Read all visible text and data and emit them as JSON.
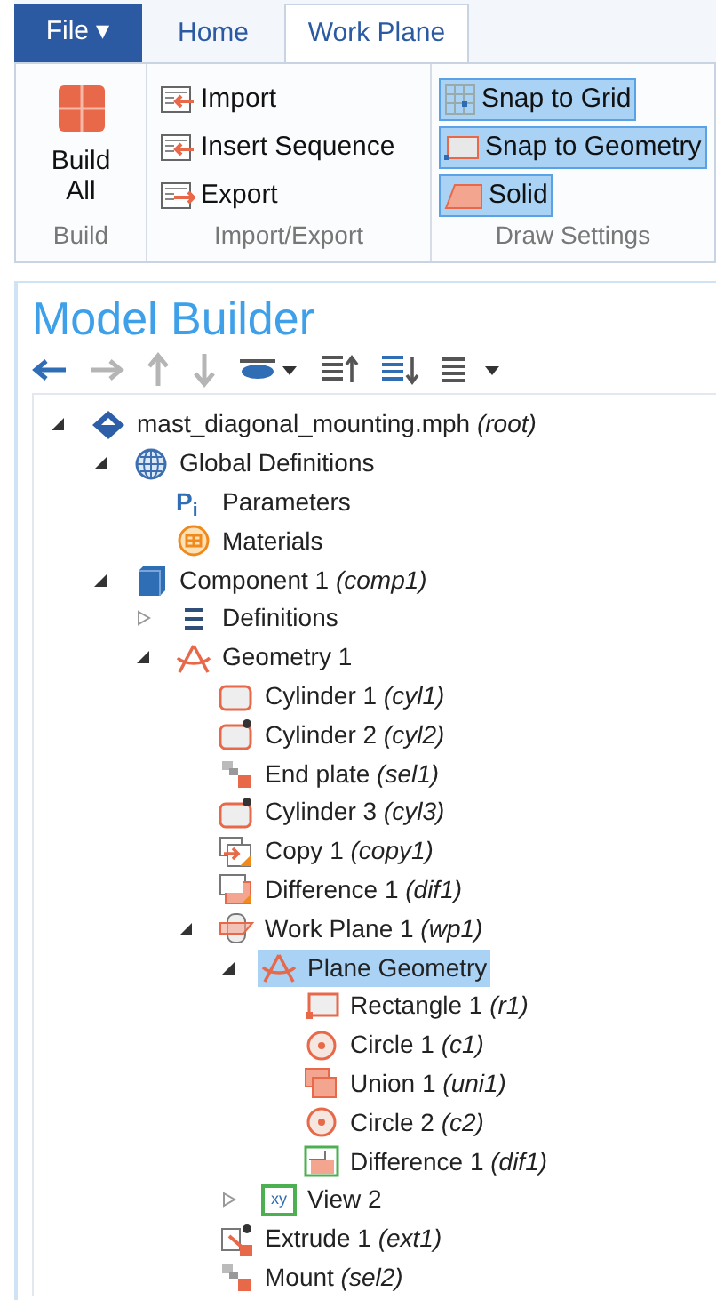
{
  "tabs": [
    {
      "label": "File ▾",
      "kind": "file",
      "selected": false
    },
    {
      "label": "Home",
      "kind": "tab",
      "selected": false
    },
    {
      "label": "Work Plane",
      "kind": "tab",
      "selected": true
    }
  ],
  "ribbon": {
    "groups": [
      {
        "label": "Build",
        "buttons": [
          {
            "label": "Build All",
            "kind": "build-all",
            "selected": false
          }
        ]
      },
      {
        "label": "Import/Export",
        "buttons": [
          {
            "label": "Import",
            "kind": "import",
            "selected": false
          },
          {
            "label": "Insert Sequence",
            "kind": "insert-sequence",
            "selected": false
          },
          {
            "label": "Export",
            "kind": "export",
            "selected": false
          }
        ]
      },
      {
        "label": "Draw Settings",
        "buttons": [
          {
            "label": "Snap to Grid",
            "kind": "snap-grid",
            "selected": true
          },
          {
            "label": "Snap to Geometry",
            "kind": "snap-geometry",
            "selected": true
          },
          {
            "label": "Solid",
            "kind": "solid",
            "selected": true
          }
        ]
      }
    ]
  },
  "model_builder": {
    "title": "Model Builder",
    "toolbar": [
      {
        "kind": "back",
        "disabled": false
      },
      {
        "kind": "forward",
        "disabled": true
      },
      {
        "kind": "up",
        "disabled": true
      },
      {
        "kind": "down",
        "disabled": true
      },
      {
        "kind": "show",
        "disabled": false
      },
      {
        "kind": "expand",
        "disabled": false
      },
      {
        "kind": "collapse",
        "disabled": false
      },
      {
        "kind": "list",
        "disabled": false
      }
    ],
    "tree": [
      {
        "label": "mast_diagonal_mounting.mph",
        "tag": "(root)",
        "kind": "root",
        "expanded": true,
        "selected": false,
        "children": [
          {
            "label": "Global Definitions",
            "kind": "globe",
            "expanded": true,
            "selected": false,
            "children": [
              {
                "label": "Parameters",
                "kind": "parameters",
                "icon_text": "P$_{i}$",
                "selected": false
              },
              {
                "label": "Materials",
                "kind": "materials",
                "selected": false
              }
            ]
          },
          {
            "label": "Component 1",
            "tag": "(comp1)",
            "kind": "component",
            "expanded": true,
            "selected": false,
            "children": [
              {
                "label": "Definitions",
                "kind": "definitions",
                "expanded": false,
                "selected": false
              },
              {
                "label": "Geometry 1",
                "kind": "geometry",
                "expanded": true,
                "selected": false,
                "children": [
                  {
                    "label": "Cylinder 1",
                    "tag": "(cyl1)",
                    "kind": "cylinder",
                    "selected": false
                  },
                  {
                    "label": "Cylinder 2",
                    "tag": "(cyl2)",
                    "kind": "cylinder-star",
                    "selected": false
                  },
                  {
                    "label": "End plate",
                    "tag": "(sel1)",
                    "kind": "selection",
                    "selected": false
                  },
                  {
                    "label": "Cylinder 3",
                    "tag": "(cyl3)",
                    "kind": "cylinder-star",
                    "selected": false
                  },
                  {
                    "label": "Copy 1",
                    "tag": "(copy1)",
                    "kind": "copy",
                    "selected": false
                  },
                  {
                    "label": "Difference 1",
                    "tag": "(dif1)",
                    "kind": "difference",
                    "selected": false
                  },
                  {
                    "label": "Work Plane 1",
                    "tag": "(wp1)",
                    "kind": "workplane",
                    "expanded": true,
                    "selected": false,
                    "children": [
                      {
                        "label": "Plane Geometry",
                        "kind": "geometry",
                        "expanded": true,
                        "selected": true,
                        "children": [
                          {
                            "label": "Rectangle 1",
                            "tag": "(r1)",
                            "kind": "rectangle",
                            "selected": false
                          },
                          {
                            "label": "Circle 1",
                            "tag": "(c1)",
                            "kind": "circle",
                            "selected": false
                          },
                          {
                            "label": "Union 1",
                            "tag": "(uni1)",
                            "kind": "union",
                            "selected": false
                          },
                          {
                            "label": "Circle 2",
                            "tag": "(c2)",
                            "kind": "circle",
                            "selected": false
                          },
                          {
                            "label": "Difference 1",
                            "tag": "(dif1)",
                            "kind": "difference-2d",
                            "selected": false
                          }
                        ]
                      },
                      {
                        "label": "View 2",
                        "kind": "view",
                        "icon_text": "xy",
                        "expanded": false,
                        "selected": false
                      }
                    ]
                  },
                  {
                    "label": "Extrude 1",
                    "tag": "(ext1)",
                    "kind": "extrude",
                    "selected": false
                  },
                  {
                    "label": "Mount",
                    "tag": "(sel2)",
                    "kind": "selection",
                    "selected": false
                  }
                ]
              }
            ]
          }
        ]
      }
    ]
  }
}
